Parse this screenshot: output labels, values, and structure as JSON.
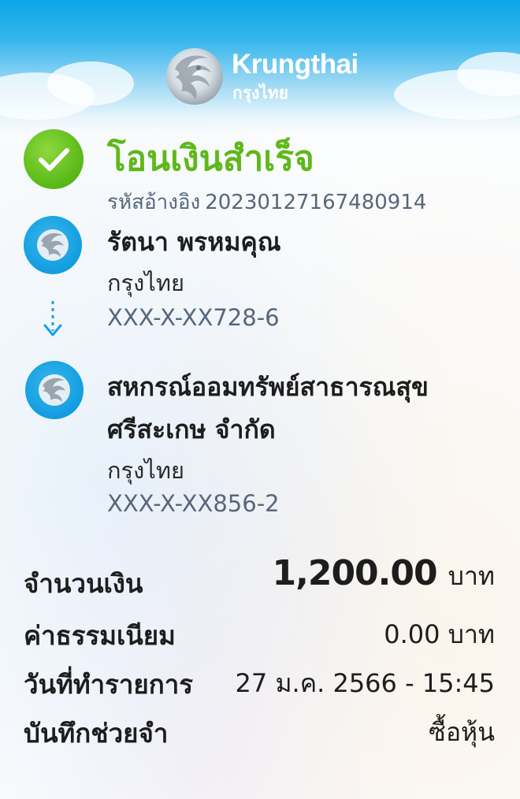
{
  "header": {
    "brand_en": "Krungthai",
    "brand_th": "กรุงไทย",
    "logo_icon": "krungthai-bird-logo",
    "gradient_top": "#0aa6e6"
  },
  "status": {
    "icon": "check-icon",
    "title": "โอนเงินสำเร็จ",
    "ref_label": "รหัสอ้างอิง",
    "ref_number": "20230127167480914",
    "color": "#5fb81a"
  },
  "sender": {
    "name": "รัตนา พรหมคุณ",
    "bank": "กรุงไทย",
    "account": "XXX-X-XX728-6"
  },
  "receiver": {
    "name_line1": "สหกรณ์ออมทรัพย์สาธารณสุข",
    "name_line2": "ศรีสะเกษ จำกัด",
    "bank": "กรุงไทย",
    "account": "XXX-X-XX856-2"
  },
  "details": {
    "amount_label": "จำนวนเงิน",
    "amount_value": "1,200.00",
    "amount_unit": "บาท",
    "fee_label": "ค่าธรรมเนียม",
    "fee_value": "0.00 บาท",
    "date_label": "วันที่ทำรายการ",
    "date_value": "27 ม.ค. 2566 - 15:45",
    "memo_label": "บันทึกช่วยจำ",
    "memo_value": "ซื้อหุ้น"
  }
}
